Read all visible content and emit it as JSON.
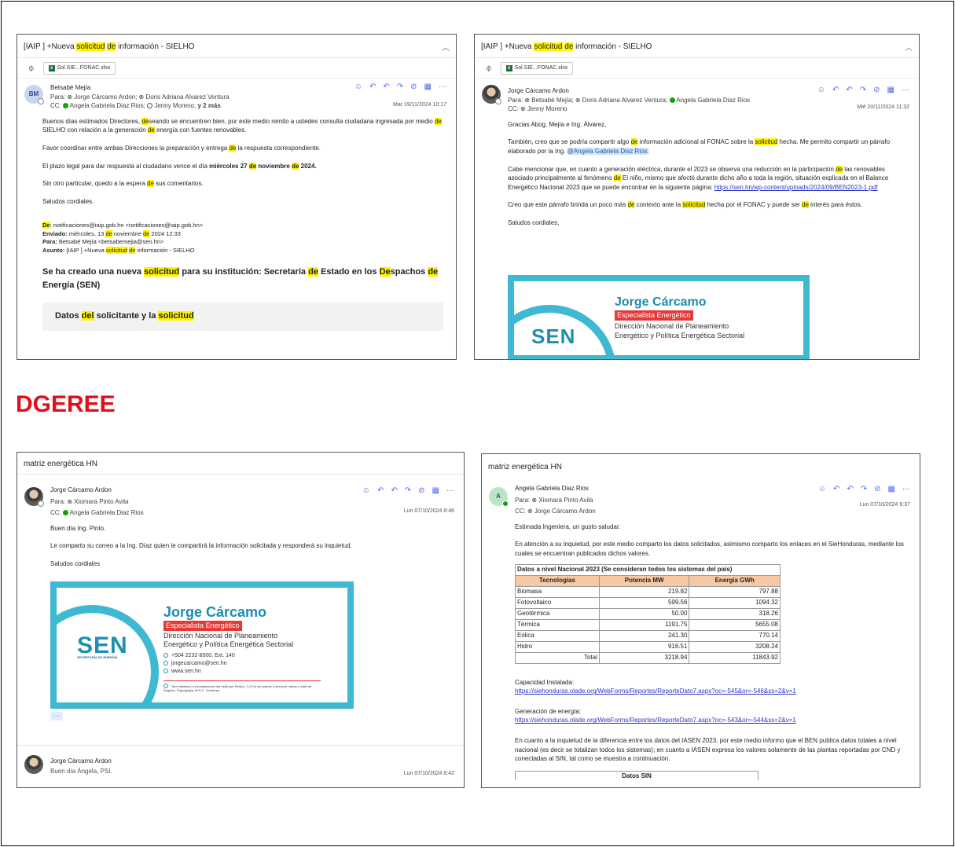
{
  "heading": "DGEREE",
  "panel1": {
    "subject_prefix": "[IAIP ] +Nueva ",
    "subject_hl1": "solicitud",
    "subject_mid": " ",
    "subject_hl2": "de",
    "subject_suffix": " información - SIELHO",
    "attachment": "Sol.SIE...FONAC.xlsx",
    "avatar_initials": "BM",
    "sender": "Betsabé Mejía",
    "to": "Para: ⊗ Jorge Cárcamo Ardon;  ⊗ Doris Adriana Alvarez Ventura",
    "cc_label": "CC:",
    "cc_1": "Angela Gabriela Diaz Rios;",
    "cc_2": "Jenny Moreno;",
    "cc_more": "y 2 más",
    "date": "Mar 19/11/2024 10:17",
    "body": {
      "l1a": "Buenos días estimados Directores, ",
      "l1hl": "de",
      "l1b": "seando se encuentren bien, por este medio remito a ustedes consulta ciudadana ingresada por medio ",
      "l1hl2": "de",
      "l1c": " SIELHO con relación a la generación ",
      "l1hl3": "de",
      "l1d": " energía con fuentes renovables.",
      "l2a": "Favor coordinar entre ambas Direcciones la preparación y entrega ",
      "l2hl": "de",
      "l2b": " la respuesta correspondiente.",
      "l3a": "El plazo legal para dar respuesta al ciudadano vence el día ",
      "l3b": "miércoles 27 ",
      "l3hl": "de",
      "l3c": " noviembre ",
      "l3hl2": "de",
      "l3d": " 2024.",
      "l4a": "Sin otro particular, quedo a la espera ",
      "l4hl": "de",
      "l4b": " sus comentarios.",
      "l5": "Saludos cordiales."
    },
    "fwd": {
      "de_label": "De",
      "de": ": notificaciones@iaip.gob.hn <notificaciones@iaip.gob.hn>",
      "enviado_label": "Enviado:",
      "enviado_a": " miércoles, 13 ",
      "enviado_b": " noviembre ",
      "enviado_c": " 2024 12:33",
      "para_label": "Para:",
      "para": " Betsabé Mejía <betsabemejia@sen.hn>",
      "asunto_label": "Asunto:",
      "asunto_a": " [IAIP ] +Nueva ",
      "asunto_b": " información - SIELHO"
    },
    "big_a": "Se ha creado una nueva ",
    "big_b": " para su institución: Secretaría ",
    "big_c": " Estado en los ",
    "big_d": "spachos ",
    "big_e": " Energía (SEN)",
    "datos_a": "Datos ",
    "datos_hl": "del",
    "datos_b": " solicitante y la ",
    "datos_hl2": "solicitud"
  },
  "panel2": {
    "attachment": "Sol.SIE...FONAC.xlsx",
    "sender": "Jorge Cárcamo Ardon",
    "to_a": "Para: ⊗ Betsabé Mejía;  ⊗ Doris Adriana Alvarez Ventura;",
    "to_b": "Angela Gabriela Diaz Rios",
    "cc": "CC: ⊗ Jenny Moreno",
    "date": "Mié 20/11/2024 11:32",
    "p1": "Gracias Abog. Mejía e Ing. Álvarez,",
    "p2a": "También, creo que se podría compartir algo ",
    "p2b": " información adicional al FONAC sobre la ",
    "p2c": " hecha. Me permito compartir un párrafo elaborado por la Ing. ",
    "p2mention": "@Angela Gabriela Diaz Rios",
    "p2d": ":",
    "p3a": "Cabe mencionar que, en cuanto a generación eléctrica, durante el 2023 se observa una reducción en la participación ",
    "p3b": " las renovables asociado principalmente al fenómeno ",
    "p3c": " El niño, mismo que afectó durante dicho año a toda la región, situación explicada en el Balance Energético Nacional 2023 que se puede encontrar en la siguiente página: ",
    "p3link": "https://sen.hn/wp-content/uploads/2024/09/BEN2023-1.pdf",
    "p4a": "Creo que este párrafo brinda un poco más ",
    "p4b": " contexto ante la ",
    "p4c": " hecha por el FONAC y puede ser ",
    "p4d": " interés para éstos.",
    "p5": "Saludos cordiales,"
  },
  "signature": {
    "logo": "SEN",
    "logo_sub": "SECRETARÍA DE ENERGÍA",
    "name": "Jorge Cárcamo",
    "role": "Especialista Energético",
    "dir1": "Dirección Nacional de Planeamiento",
    "dir2": "Energético y Política Energética Sectorial",
    "phone": "+504 2232-8500, Ext. 140",
    "email": "jorgecarcamo@sen.hn",
    "web": "www.sen.hn",
    "address": "Torre Altamira, a inmediaciones del estilo per Petrico, 1,0 Km del puente a desnivel, salida a Valle de Ángeles, Tegucigalpa, M.D.C. Honduras."
  },
  "panel3": {
    "subject": "matriz energética HN",
    "sender": "Jorge Cárcamo Ardon",
    "to": "Para: ⊗ Xiomara Pinto Avila",
    "cc_label": "CC:",
    "cc": "Angela Gabriela Diaz Rios",
    "date": "Lun 07/10/2024 8:46",
    "p1": "Buen día Ing. Pinto.",
    "p2": "Le comparto su correo a la Ing. Díaz quien le compartirá la información solicitada y responderá su inquietud.",
    "p3": "Saludos cordiales",
    "ellipsis": "···",
    "reply_sender": "Jorge Cárcamo Ardon",
    "reply_preview": "Buen día Ángela, PSI.",
    "reply_date": "Lun 07/10/2024 8:42"
  },
  "panel4": {
    "subject": "matriz energética HN",
    "avatar_initials": "A",
    "sender": "Angela Gabriela Diaz Rios",
    "to": "Para: ⊗ Xiomara Pinto Avila",
    "cc": "CC: ⊗ Jorge Cárcamo Ardon",
    "date": "Lun 07/10/2024 9:37",
    "p1": "Estimada Ingeniera, un gusto saludar.",
    "p2": "En atención a su inquietud, por este medio comparto los datos solicitados, asimismo comparto los enlaces en el SieHonduras, mediante los cuales se encuentran publicados dichos valores.",
    "table_caption": "Datos a nivel Nacional 2023 (Se consideran todos los sistemas del país)",
    "table_headers": [
      "Tecnologías",
      "Potencia MW",
      "Energía GWh"
    ],
    "table_rows": [
      [
        "Biomasa",
        "219.82",
        "797.88"
      ],
      [
        "Fotovoltaico",
        "599.56",
        "1094.32"
      ],
      [
        "Geotérmica",
        "50.00",
        "318.26"
      ],
      [
        "Térmica",
        "1191.75",
        "5655.08"
      ],
      [
        "Eólica",
        "241.30",
        "770.14"
      ],
      [
        "Hidro",
        "916.51",
        "3208.24"
      ],
      [
        "Total",
        "3218.94",
        "11843.92"
      ]
    ],
    "cap_label": "Capacidad Instalada:",
    "cap_link": "https://siehonduras.olade.org/WebForms/Reportes/ReporteDato7.aspx?oc=-545&or=-546&ss=2&v=1",
    "gen_label": "Generación de energía:",
    "gen_link": "https://siehonduras.olade.org/WebForms/Reportes/ReporteDato7.aspx?oc=-543&or=-544&ss=2&v=1",
    "p3": "En cuanto a la inquietud de la diferencia entre los datos del IASEN 2023, por este medio informo que el BEN publica datos totales a nivel nacional (es decir se totalizan todos los sistemas); en cuanto a IASEN expresa los valores solamente de las plantas reportadas por CND y conectadas al SIN, tal como se muestra a continuación.",
    "cut_table": "Datos SIN"
  },
  "actions": [
    "☺",
    "↶",
    "↶",
    "↷",
    "⊘",
    "▦",
    "···"
  ],
  "hl_de": "de",
  "hl_solicitud": "solicitud",
  "hl_De": "De"
}
